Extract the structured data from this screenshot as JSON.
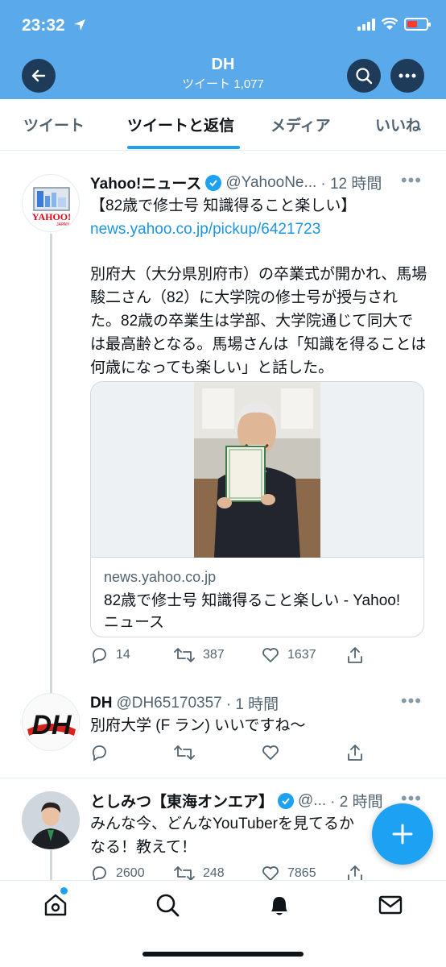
{
  "status_bar": {
    "time": "23:32"
  },
  "header": {
    "title": "DH",
    "subtitle": "ツイート 1,077"
  },
  "tabs": [
    {
      "label": "ツイート",
      "active": false
    },
    {
      "label": "ツイートと返信",
      "active": true
    },
    {
      "label": "メディア",
      "active": false
    },
    {
      "label": "いいね",
      "active": false
    }
  ],
  "tweets": [
    {
      "name": "Yahoo!ニュース",
      "handle": "@YahooNe...",
      "time": "· 12 時間",
      "verified": true,
      "headline": "【82歳で修士号 知識得ること楽しい】",
      "link": "news.yahoo.co.jp/pickup/6421723",
      "body": "別府大（大分県別府市）の卒業式が開かれ、馬場駿二さん（82）に大学院の修士号が授与された。82歳の卒業生は学部、大学院通じて同大では最高齢となる。馬場さんは「知識を得ることは何歳になっても楽しい」と話した。",
      "card": {
        "domain": "news.yahoo.co.jp",
        "title": "82歳で修士号 知識得ること楽しい - Yahoo!ニュース"
      },
      "avatar_text": "YAHOO!",
      "avatar_sub": "JAPAN",
      "replies": "14",
      "retweets": "387",
      "likes": "1637"
    },
    {
      "name": "DH",
      "handle": "@DH65170357",
      "time": "· 1 時間",
      "verified": false,
      "body": "別府大学 (F ラン) いいですね〜",
      "avatar_text": "DH",
      "replies": "",
      "retweets": "",
      "likes": ""
    },
    {
      "name": "としみつ【東海オンエア】",
      "handle": "@...",
      "time": "· 2 時間",
      "verified": true,
      "body": "みんな今、どんなYouTuberを見てるか\nなる！教えて！",
      "replies": "2600",
      "retweets": "248",
      "likes": "7865"
    }
  ],
  "colors": {
    "header": "#5aa9ea",
    "accent": "#1da1f2",
    "text": "#0f1419",
    "muted": "#536471"
  }
}
